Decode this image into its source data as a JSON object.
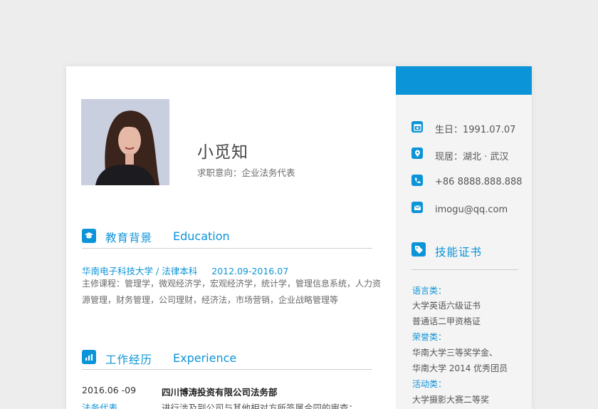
{
  "header": {
    "name": "小觅知",
    "intent": "求职意向：企业法务代表"
  },
  "education": {
    "title": "教育背景",
    "title_en": "Education",
    "school": "华南电子科技大学",
    "separator": "/",
    "degree": "法律本科",
    "dates": "2012.09-2016.07",
    "courses_line1": "主修课程：管理学，微观经济学，宏观经济学，统计学，管理信息系统，人力资",
    "courses_line2": "源管理，财务管理，公司理财，经济法，市场营销，企业战略管理等"
  },
  "experience": {
    "title": "工作经历",
    "title_en": "Experience",
    "date": "2016.06 -09",
    "company": "四川博涛投资有限公司法务部",
    "role": "法务代表",
    "desc": "进行涉及到公司与其他相对方所签属合同的审查；"
  },
  "contact": {
    "birthday": "生日：1991.07.07",
    "location": "现居：湖北 · 武汉",
    "phone": "+86 8888.888.888",
    "email": "imogu@qq.com"
  },
  "skills": {
    "title": "技能证书",
    "language_label": "语言类：",
    "language_items": [
      "大学英语六级证书",
      "普通话二甲资格证"
    ],
    "honor_label": "荣誉类：",
    "honor_items": [
      "华南大学三等奖学金、",
      "华南大学 2014 优秀团员"
    ],
    "activity_label": "活动类：",
    "activity_items": [
      "大学摄影大赛二等奖"
    ]
  },
  "colors": {
    "accent": "#0c94d8",
    "background": "#ededed",
    "sidebar": "#f4f4f4"
  },
  "icons": [
    "calendar-icon",
    "location-icon",
    "phone-icon",
    "email-icon",
    "tag-icon",
    "graduation-cap-icon",
    "bar-chart-icon"
  ]
}
